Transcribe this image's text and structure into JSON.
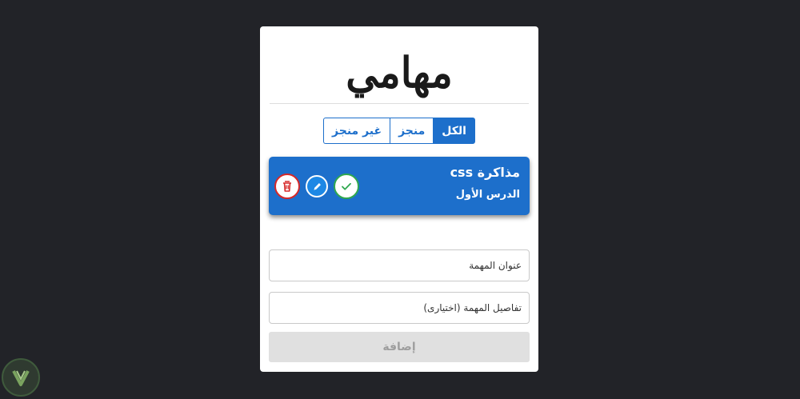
{
  "app": {
    "logo_text": "مهامي"
  },
  "filters": [
    {
      "label": "الكل",
      "active": true
    },
    {
      "label": "منجز",
      "active": false
    },
    {
      "label": "غير منجز",
      "active": false
    }
  ],
  "tasks": [
    {
      "title": "مذاكرة css",
      "details": "الدرس الأول",
      "actions": [
        "delete-icon",
        "edit-icon",
        "check-icon"
      ]
    }
  ],
  "form": {
    "title_placeholder": "عنوان المهمة",
    "details_placeholder": "تفاصيل المهمة (اختيارى)",
    "title_value": "",
    "details_value": "",
    "add_label": "إضافة"
  },
  "colors": {
    "background": "#222328",
    "accent": "#1d6fcb",
    "delete": "#d62828",
    "done": "#2fa84f",
    "disabled": "#e0e0e0"
  },
  "watermark": {
    "icon": "v-logo-icon"
  }
}
